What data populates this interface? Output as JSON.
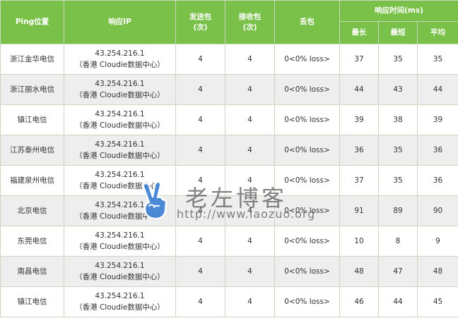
{
  "header": {
    "location": "Ping位置",
    "ip": "响应IP",
    "sent": "发送包\n(次)",
    "received": "接收包\n(次)",
    "loss": "丢包",
    "response_time": "响应时间(ms)",
    "max": "最长",
    "min": "最短",
    "avg": "平均"
  },
  "rows": [
    {
      "location": "浙江金华电信",
      "ip": "43.254.216.1",
      "ip_note": "（香港 Cloudie数据中心）",
      "sent": "4",
      "received": "4",
      "loss": "0<0% loss>",
      "max": "37",
      "min": "35",
      "avg": "35"
    },
    {
      "location": "浙江丽水电信",
      "ip": "43.254.216.1",
      "ip_note": "（香港 Cloudie数据中心）",
      "sent": "4",
      "received": "4",
      "loss": "0<0% loss>",
      "max": "44",
      "min": "43",
      "avg": "44"
    },
    {
      "location": "镇江电信",
      "ip": "43.254.216.1",
      "ip_note": "（香港 Cloudie数据中心）",
      "sent": "4",
      "received": "4",
      "loss": "0<0% loss>",
      "max": "39",
      "min": "38",
      "avg": "39"
    },
    {
      "location": "江苏泰州电信",
      "ip": "43.254.216.1",
      "ip_note": "（香港 Cloudie数据中心）",
      "sent": "4",
      "received": "4",
      "loss": "0<0% loss>",
      "max": "36",
      "min": "35",
      "avg": "36"
    },
    {
      "location": "福建泉州电信",
      "ip": "43.254.216.1",
      "ip_note": "（香港 Cloudie数据中心）",
      "sent": "4",
      "received": "4",
      "loss": "0<0% loss>",
      "max": "37",
      "min": "35",
      "avg": "36"
    },
    {
      "location": "北京电信",
      "ip": "43.254.216.1",
      "ip_note": "（香港 Cloudie数据中心）",
      "sent": "4",
      "received": "4",
      "loss": "0<0% loss>",
      "max": "91",
      "min": "89",
      "avg": "90"
    },
    {
      "location": "东莞电信",
      "ip": "43.254.216.1",
      "ip_note": "（香港 Cloudie数据中心）",
      "sent": "4",
      "received": "4",
      "loss": "0<0% loss>",
      "max": "10",
      "min": "8",
      "avg": "9"
    },
    {
      "location": "南昌电信",
      "ip": "43.254.216.1",
      "ip_note": "（香港 Cloudie数据中心）",
      "sent": "4",
      "received": "4",
      "loss": "0<0% loss>",
      "max": "48",
      "min": "47",
      "avg": "48"
    },
    {
      "location": "镇江电信",
      "ip": "43.254.216.1",
      "ip_note": "（香港 Cloudie数据中心）",
      "sent": "4",
      "received": "4",
      "loss": "0<0% loss>",
      "max": "46",
      "min": "44",
      "avg": "45"
    }
  ],
  "watermark": {
    "title": "老左博客",
    "url": "http://www.laozuo.org",
    "icon": "victory-hand-icon"
  },
  "colors": {
    "header_bg": "#79c149",
    "row_alt_bg": "#eeeeee",
    "border": "#c9d8bf",
    "watermark_icon": "#3a7fd5"
  }
}
